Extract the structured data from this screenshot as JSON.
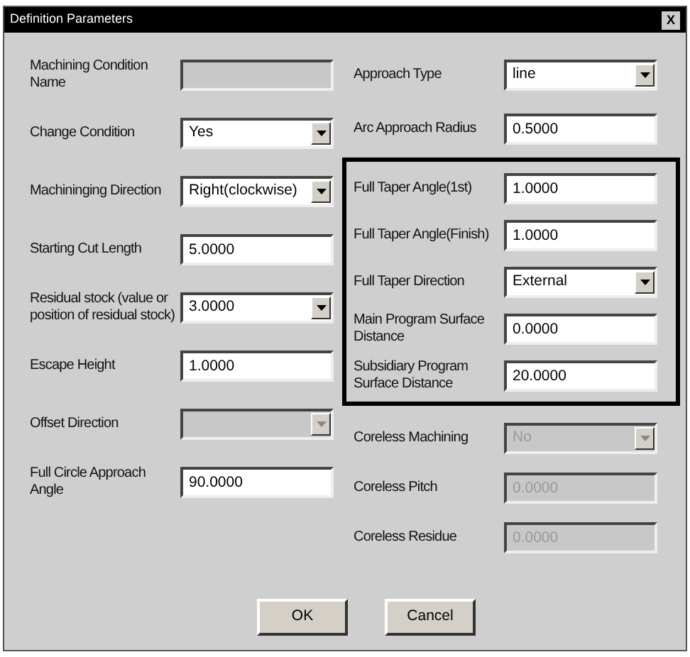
{
  "window": {
    "title": "Definition Parameters",
    "close": "X"
  },
  "left_fields": [
    {
      "label": "Machining Condition Name",
      "kind": "text",
      "disabled": true
    },
    {
      "label": "Change Condition",
      "kind": "dropdown",
      "value": "Yes",
      "disabled": false
    },
    {
      "label": "Machininging Direction",
      "kind": "dropdown",
      "value": "Right(clockwise)",
      "disabled": false
    },
    {
      "label": "Starting Cut Length",
      "kind": "text",
      "value": "5.0000",
      "disabled": false
    },
    {
      "label": "Residual stock (value or position of residual stock)",
      "kind": "dropdown",
      "value": "3.0000",
      "disabled": false
    },
    {
      "label": "Escape Height",
      "kind": "text",
      "value": "1.0000",
      "disabled": false
    },
    {
      "label": "Offset Direction",
      "kind": "dropdown",
      "disabled": true
    },
    {
      "label": "Full Circle Approach Angle",
      "kind": "text",
      "value": "90.0000",
      "disabled": false
    }
  ],
  "right_fields": [
    {
      "label": "Approach Type",
      "kind": "dropdown",
      "value": "line",
      "disabled": false
    },
    {
      "label": "Arc Approach Radius",
      "kind": "text",
      "value": "0.5000",
      "disabled": false
    }
  ],
  "highlighted_fields": [
    {
      "label": "Full Taper Angle(1st)",
      "kind": "text",
      "value": "1.0000",
      "disabled": false
    },
    {
      "label": "Full Taper Angle(Finish)",
      "kind": "text",
      "value": "1.0000",
      "disabled": false
    },
    {
      "label": "Full Taper Direction",
      "kind": "dropdown",
      "value": "External",
      "disabled": false
    },
    {
      "label": "Main Program Surface Distance",
      "kind": "text",
      "value": "0.0000",
      "disabled": false
    },
    {
      "label": "Subsidiary Program Surface Distance",
      "kind": "text",
      "value": "20.0000",
      "disabled": false
    }
  ],
  "lower_right_fields": [
    {
      "label": "Coreless Machining",
      "kind": "dropdown",
      "value": "No",
      "disabled": true
    },
    {
      "label": "Coreless Pitch",
      "kind": "text",
      "value": "0.0000",
      "disabled": true
    },
    {
      "label": "Coreless Residue",
      "kind": "text",
      "value": "0.0000",
      "disabled": true
    }
  ],
  "buttons": [
    "OK",
    "Cancel"
  ]
}
